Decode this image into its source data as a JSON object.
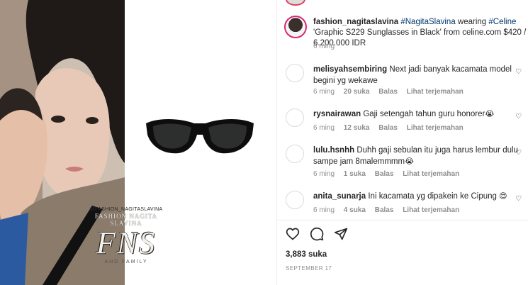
{
  "post": {
    "watermark": {
      "handle": "@FASHION_NAGITASLAVINA",
      "title": "FASHION NAGITA SLAVINA",
      "logo": "FNS",
      "footer": "AND FAMILY"
    },
    "caption": {
      "username": "fashion_nagitaslavina",
      "tag1": "#NagitaSlavina",
      "text1": " wearing ",
      "tag2": "#Celine",
      "text2": " 'Graphic S229 Sunglasses in Black' from celine.com $420 / 6.200.000 IDR",
      "time": "6 ming"
    },
    "comments": [
      {
        "username": "melisyahsembiring",
        "text": "Next jadi banyak kacamata model begini yg wekawe",
        "time": "6 ming",
        "likes": "20 suka",
        "reply": "Balas",
        "translate": "Lihat terjemahan",
        "emoji": ""
      },
      {
        "username": "rysnairawan",
        "text": "Gaji setengah tahun guru honorer",
        "time": "6 ming",
        "likes": "12 suka",
        "reply": "Balas",
        "translate": "Lihat terjemahan",
        "emoji": "😭"
      },
      {
        "username": "lulu.hsnhh",
        "text": "Duhh gaji sebulan itu juga harus lembur dulu sampe jam 8malemmmm",
        "time": "6 ming",
        "likes": "1 suka",
        "reply": "Balas",
        "translate": "Lihat terjemahan",
        "emoji": "😭"
      },
      {
        "username": "anita_sunarja",
        "text": "Ini kacamata yg dipakein ke Cipung",
        "time": "6 ming",
        "likes": "4 suka",
        "reply": "Balas",
        "translate": "Lihat terjemahan",
        "emoji": "😍"
      }
    ],
    "likes_count": "3,883 suka",
    "date": "SEPTEMBER 17",
    "icons": [
      "heart-icon",
      "comment-icon",
      "share-icon"
    ],
    "colors": {
      "link": "#00376b",
      "meta": "#8e8e8e",
      "text": "#262626",
      "story_ring": "#d62976"
    }
  }
}
